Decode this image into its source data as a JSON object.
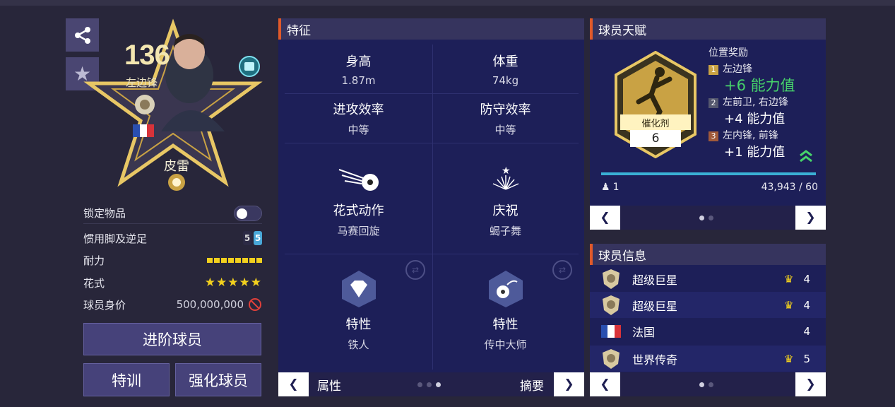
{
  "player": {
    "ovr": "136",
    "position": "左边锋",
    "name": "皮雷",
    "share_icon": "share-icon",
    "favorite_icon": "star-icon"
  },
  "stats": {
    "lock_label": "锁定物品",
    "foot_label": "惯用脚及逆足",
    "foot_left": "5",
    "foot_right": "5",
    "stamina_label": "耐力",
    "skill_label": "花式",
    "skill_stars": "★★★★★",
    "value_label": "球员身价",
    "value": "500,000,000"
  },
  "buttons": {
    "advance": "进阶球员",
    "train": "特训",
    "enhance": "强化球员"
  },
  "traits": {
    "title": "特征",
    "height_label": "身高",
    "height": "1.87m",
    "weight_label": "体重",
    "weight": "74kg",
    "att_label": "进攻效率",
    "att": "中等",
    "def_label": "防守效率",
    "def": "中等",
    "skill_move_label": "花式动作",
    "skill_move": "马赛回旋",
    "celebration_label": "庆祝",
    "celebration": "蝎子舞",
    "trait1_label": "特性",
    "trait1": "铁人",
    "trait2_label": "特性",
    "trait2": "传中大师",
    "nav_left": "属性",
    "nav_right": "摘要"
  },
  "talent": {
    "title": "球员天赋",
    "badge_label": "催化剂",
    "badge_level": "6",
    "bonus_title": "位置奖励",
    "bonuses": [
      {
        "rank": "1",
        "positions": "左边锋",
        "value": "+6 能力值"
      },
      {
        "rank": "2",
        "positions": "左前卫, 右边锋",
        "value": "+4 能力值"
      },
      {
        "rank": "3",
        "positions": "左内锋, 前锋",
        "value": "+1 能力值"
      }
    ],
    "count": "1",
    "progress": "43,943 / 60"
  },
  "info": {
    "title": "球员信息",
    "rows": [
      {
        "label": "超级巨星",
        "value": "4"
      },
      {
        "label": "超级巨星",
        "value": "4"
      },
      {
        "label": "法国",
        "value": "4"
      },
      {
        "label": "世界传奇",
        "value": "5"
      }
    ]
  },
  "colors": {
    "accent_orange": "#e0592a",
    "bonus_green": "#46d36a",
    "gold": "#f2d01e"
  }
}
